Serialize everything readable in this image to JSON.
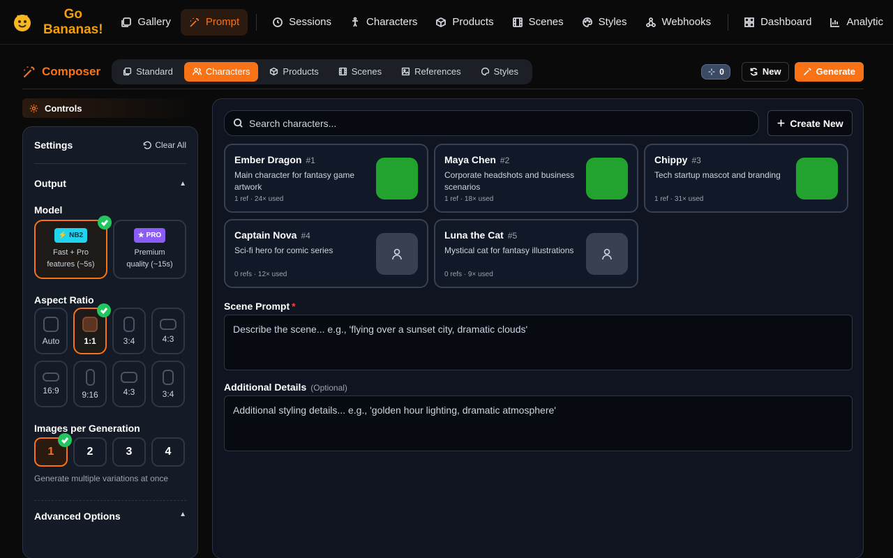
{
  "app": {
    "logo_line1": "Go",
    "logo_line2": "Bananas!"
  },
  "nav": {
    "items": [
      {
        "label": "Gallery",
        "icon": "gallery-icon"
      },
      {
        "label": "Prompt",
        "icon": "wand-icon",
        "active": true
      },
      {
        "label": "Sessions",
        "icon": "clock-icon"
      },
      {
        "label": "Characters",
        "icon": "person-icon"
      },
      {
        "label": "Products",
        "icon": "box-icon"
      },
      {
        "label": "Scenes",
        "icon": "film-icon"
      },
      {
        "label": "Styles",
        "icon": "palette-icon"
      },
      {
        "label": "Webhooks",
        "icon": "webhook-icon"
      },
      {
        "label": "Dashboard",
        "icon": "grid-icon"
      },
      {
        "label": "Analytic",
        "icon": "chart-icon"
      }
    ]
  },
  "composer": {
    "title": "Composer",
    "tabs": [
      {
        "label": "Standard"
      },
      {
        "label": "Characters",
        "active": true
      },
      {
        "label": "Products"
      },
      {
        "label": "Scenes"
      },
      {
        "label": "References"
      },
      {
        "label": "Styles"
      }
    ],
    "counter": "0",
    "new_label": "New",
    "generate_label": "Generate"
  },
  "controls": {
    "header": "Controls",
    "settings_title": "Settings",
    "clear_all": "Clear All",
    "output_label": "Output",
    "model_label": "Model",
    "models": [
      {
        "badge": "⚡ NB2",
        "line1": "Fast + Pro",
        "line2": "features (~5s)",
        "selected": true
      },
      {
        "badge": "★ PRO",
        "line1": "Premium",
        "line2": "quality (~15s)",
        "selected": false
      }
    ],
    "aspect_label": "Aspect Ratio",
    "aspect_ratios": [
      {
        "label": "Auto"
      },
      {
        "label": "1:1",
        "selected": true
      },
      {
        "label": "3:4"
      },
      {
        "label": "4:3"
      },
      {
        "label": "16:9"
      },
      {
        "label": "9:16"
      },
      {
        "label": "4:3"
      },
      {
        "label": "3:4"
      }
    ],
    "images_label": "Images per Generation",
    "images_options": [
      "1",
      "2",
      "3",
      "4"
    ],
    "images_selected": "1",
    "images_hint": "Generate multiple variations at once",
    "advanced_label": "Advanced Options"
  },
  "main": {
    "search_placeholder": "Search characters...",
    "create_new": "Create New",
    "characters": [
      {
        "name": "Ember Dragon",
        "num": "#1",
        "desc": "Main character for fantasy game artwork",
        "meta": "1 ref · 24× used",
        "has_image": true,
        "color": "#22a32f"
      },
      {
        "name": "Maya Chen",
        "num": "#2",
        "desc": "Corporate headshots and business scenarios",
        "meta": "1 ref · 18× used",
        "has_image": true,
        "color": "#22a32f"
      },
      {
        "name": "Chippy",
        "num": "#3",
        "desc": "Tech startup mascot and branding",
        "meta": "1 ref · 31× used",
        "has_image": true,
        "color": "#22a32f"
      },
      {
        "name": "Captain Nova",
        "num": "#4",
        "desc": "Sci-fi hero for comic series",
        "meta": "0 refs · 12× used",
        "has_image": false
      },
      {
        "name": "Luna the Cat",
        "num": "#5",
        "desc": "Mystical cat for fantasy illustrations",
        "meta": "0 refs · 9× used",
        "has_image": false
      }
    ],
    "scene_prompt_label": "Scene Prompt",
    "scene_prompt_required": "*",
    "scene_prompt_placeholder": "Describe the scene... e.g., 'flying over a sunset city, dramatic clouds'",
    "additional_label": "Additional Details",
    "additional_optional": "(Optional)",
    "additional_placeholder": "Additional styling details... e.g., 'golden hour lighting, dramatic atmosphere'"
  },
  "colors": {
    "accent": "#f97316",
    "success": "#22c55e",
    "panel": "#0f1420"
  }
}
